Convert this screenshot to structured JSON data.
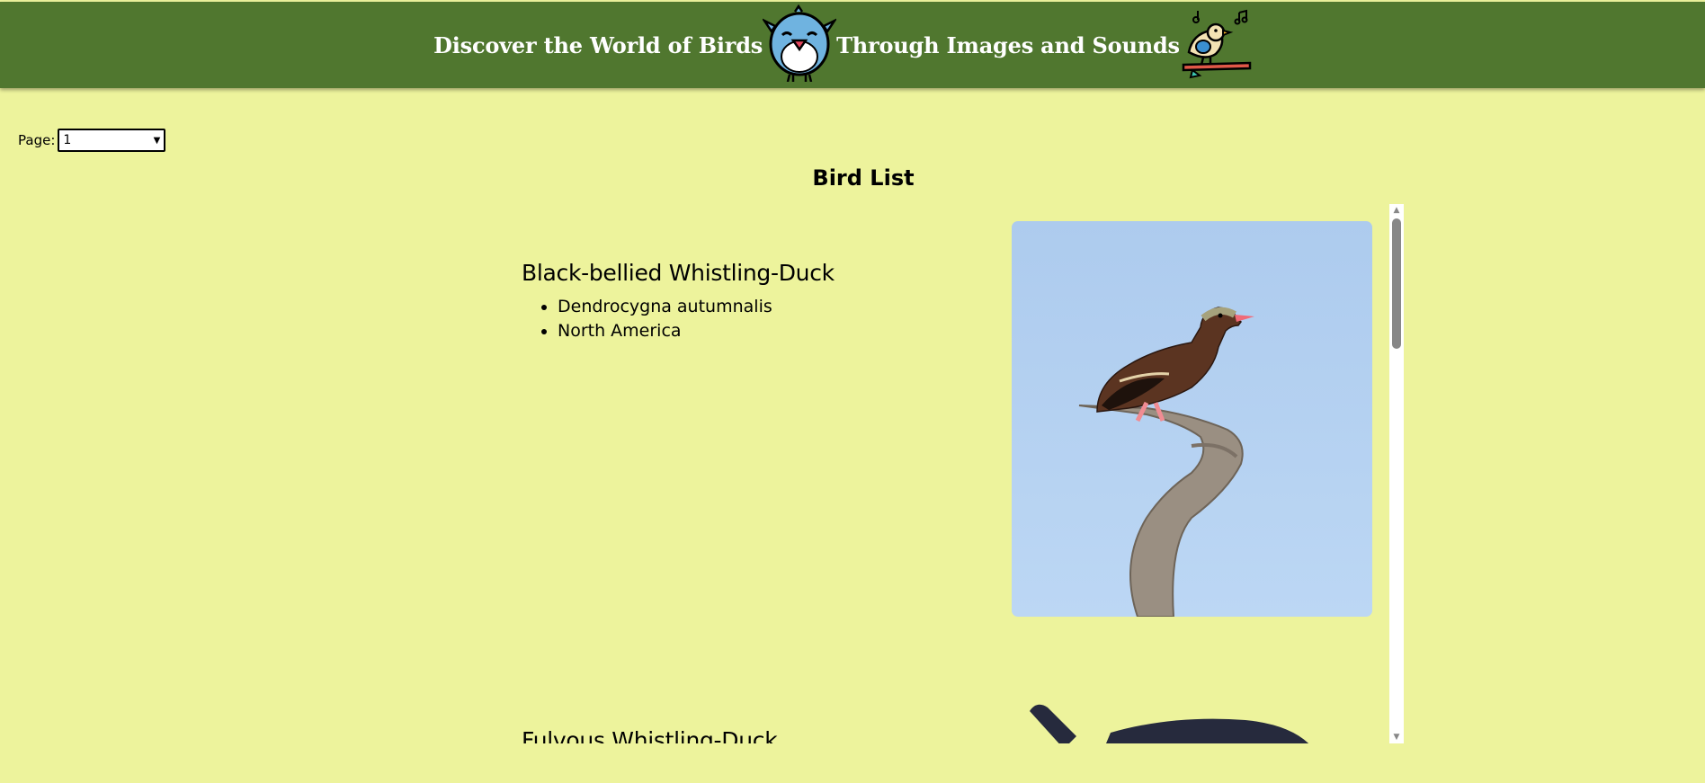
{
  "header": {
    "title_part1": "Discover the World of Birds",
    "title_part2": "Through Images and Sounds",
    "icons": [
      "happy-bird-icon",
      "singing-bird-on-branch-icon"
    ],
    "background_color": "#50772f"
  },
  "page_control": {
    "label": "Page:",
    "selected": "1"
  },
  "list_title": "Bird List",
  "birds": [
    {
      "name": "Black-bellied Whistling-Duck",
      "scientific_name": "Dendrocygna autumnalis",
      "region": "North America"
    },
    {
      "name": "Fulvous Whistling-Duck"
    }
  ],
  "colors": {
    "page_background": "#edf39c",
    "header_background": "#50772f",
    "header_text": "#ffffff"
  }
}
